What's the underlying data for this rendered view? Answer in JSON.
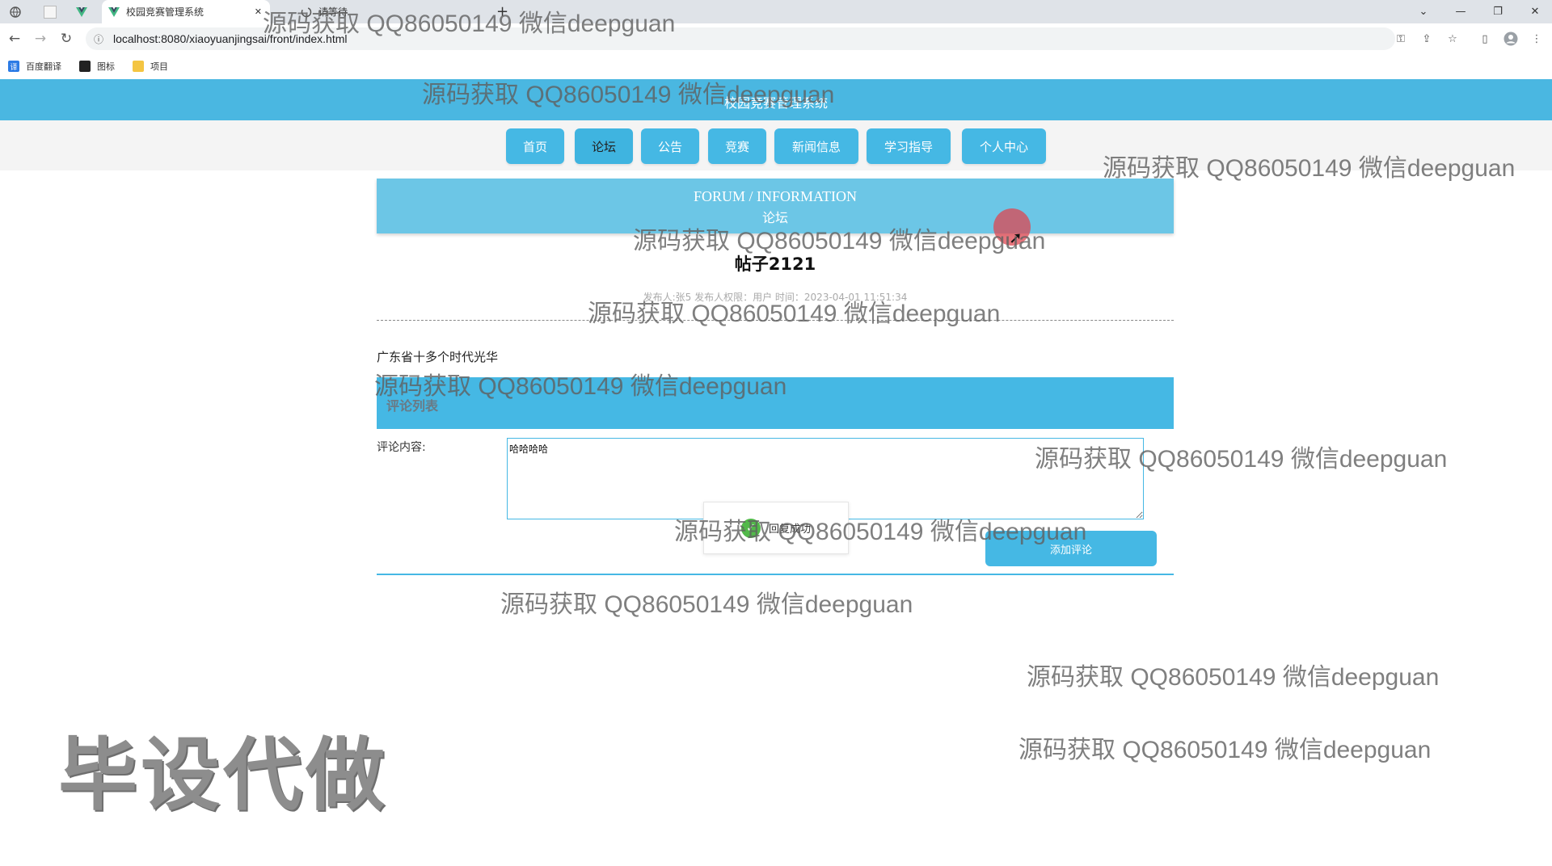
{
  "browser": {
    "tabs": [
      {
        "label": ""
      },
      {
        "label": ""
      },
      {
        "label": "校园竞赛管理系统"
      },
      {
        "label": "请等待"
      }
    ],
    "url": "localhost:8080/xiaoyuanjingsai/front/index.html",
    "bookmarks": [
      {
        "label": "百度翻译"
      },
      {
        "label": "图标"
      },
      {
        "label": "项目"
      }
    ]
  },
  "site": {
    "title": "校园竞赛管理系统",
    "nav": [
      {
        "label": "首页"
      },
      {
        "label": "论坛"
      },
      {
        "label": "公告"
      },
      {
        "label": "竞赛"
      },
      {
        "label": "新闻信息"
      },
      {
        "label": "学习指导"
      },
      {
        "label": "个人中心"
      }
    ],
    "active_nav": "论坛",
    "breadcrumb": {
      "en": "FORUM / INFORMATION",
      "cn": "论坛"
    }
  },
  "post": {
    "title": "帖子2121",
    "meta": "发布人:张5  发布人权限：用户  时间：2023-04-01 11:51:34",
    "content": "广东省十多个时代光华"
  },
  "comments": {
    "header": "评论列表",
    "form_label": "评论内容:",
    "input_value": "哈哈哈哈",
    "submit_label": "添加评论",
    "toast": "回复成功"
  },
  "overlay": {
    "watermark": "源码获取 QQ86050149 微信deepguan",
    "stamp": "毕设代做"
  },
  "colors": {
    "primary": "#45b8e4",
    "header": "#4ab7e1",
    "breadcrumb": "#6cc6e6"
  }
}
